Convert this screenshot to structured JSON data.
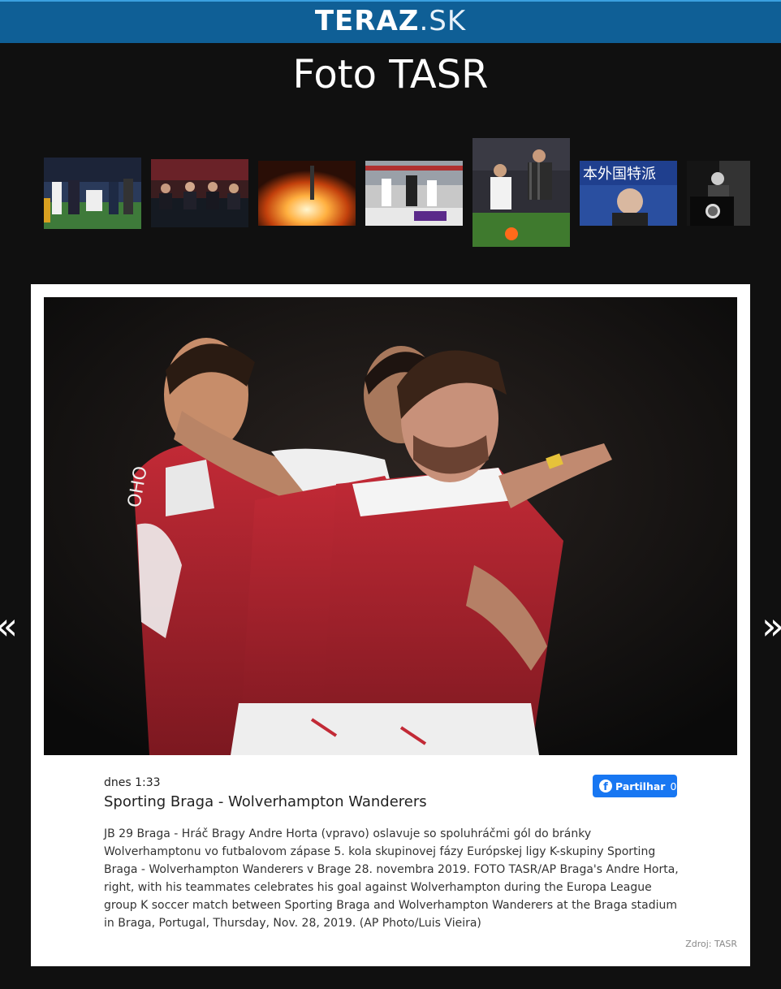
{
  "header": {
    "logo_bold": "TERAZ",
    "logo_light": ".SK"
  },
  "gallery": {
    "title": "Foto TASR",
    "thumbnails": [
      {
        "name": "thumb-football-injury"
      },
      {
        "name": "thumb-vip-stands"
      },
      {
        "name": "thumb-missile-launch"
      },
      {
        "name": "thumb-football-match"
      },
      {
        "name": "thumb-football-tackle",
        "selected": true
      },
      {
        "name": "thumb-japanese-press"
      },
      {
        "name": "thumb-president-podium"
      }
    ]
  },
  "photo": {
    "date": "dnes 1:33",
    "title": "Sporting Braga - Wolverhampton Wanderers",
    "description": "JB 29 Braga - Hráč Bragy Andre Horta (vpravo) oslavuje so spoluhráčmi gól do bránky Wolverhamptonu vo futbalovom zápase 5. kola skupinovej fázy Európskej ligy K-skupiny Sporting Braga - Wolverhampton Wanderers v Brage 28. novembra 2019. FOTO TASR/AP Braga's Andre Horta, right, with his teammates celebrates his goal against Wolverhampton during the Europa League group K soccer match between Sporting Braga and Wolverhampton Wanderers at the Braga stadium in Braga, Portugal, Thursday, Nov. 28, 2019. (AP Photo/Luis Vieira)",
    "source": "Zdroj: TASR",
    "jersey_text": "OHO"
  },
  "share": {
    "label": "Partilhar",
    "count": "0",
    "icon": "facebook-icon"
  },
  "nav": {
    "prev": "«",
    "next": "»"
  },
  "colors": {
    "header_bg": "#0f5f96",
    "page_bg": "#101010",
    "facebook": "#1877f2",
    "braga_red": "#b32531"
  }
}
